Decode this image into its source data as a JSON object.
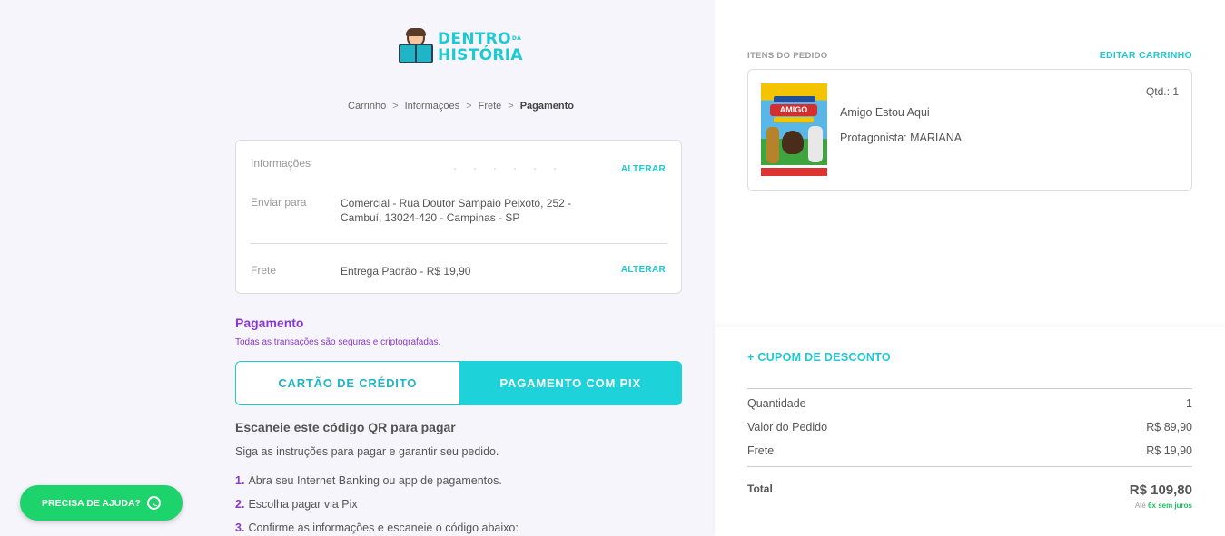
{
  "brand": {
    "line1": "DENTRO",
    "line1_small": "DA",
    "line2": "HISTÓRIA"
  },
  "breadcrumb": {
    "items": [
      "Carrinho",
      "Informações",
      "Frete",
      "Pagamento"
    ],
    "separator": ">"
  },
  "info": {
    "informacoes_label": "Informações",
    "alterar_label": "ALTERAR",
    "enviar_label": "Enviar para",
    "address_line1": "Comercial - Rua Doutor Sampaio Peixoto, 252 -",
    "address_line2": "Cambuí, 13024-420 - Campinas - SP",
    "frete_label": "Frete",
    "frete_value": "Entrega Padrão - R$ 19,90"
  },
  "payment": {
    "title": "Pagamento",
    "subtitle": "Todas as transações são seguras e criptografadas.",
    "tab_credit": "CARTÃO DE CRÉDITO",
    "tab_pix": "PAGAMENTO COM PIX",
    "qr_title": "Escaneie este código QR para pagar",
    "qr_sub": "Siga as instruções para pagar e garantir seu pedido.",
    "steps": [
      {
        "num": "1.",
        "text": "Abra seu Internet Banking ou app de pagamentos."
      },
      {
        "num": "2.",
        "text": "Escolha pagar via Pix"
      },
      {
        "num": "3.",
        "text": "Confirme as informações e escaneie o código abaixo:"
      }
    ]
  },
  "help": {
    "label": "PRECISA DE AJUDA?"
  },
  "order": {
    "items_heading": "ITENS DO PEDIDO",
    "edit_cart": "EDITAR CARRINHO",
    "item": {
      "cover_text": "AMIGO",
      "qty": "Qtd.: 1",
      "name": "Amigo Estou Aqui",
      "protagonist": "Protagonista: MARIANA"
    }
  },
  "summary": {
    "coupon": "+ CUPOM DE DESCONTO",
    "rows": [
      {
        "label": "Quantidade",
        "value": "1"
      },
      {
        "label": "Valor do Pedido",
        "value": "R$ 89,90"
      },
      {
        "label": "Frete",
        "value": "R$ 19,90"
      }
    ],
    "total_label": "Total",
    "total_value": "R$ 109,80",
    "installments_prefix": "Até",
    "installments_highlight": "6x sem juros"
  }
}
